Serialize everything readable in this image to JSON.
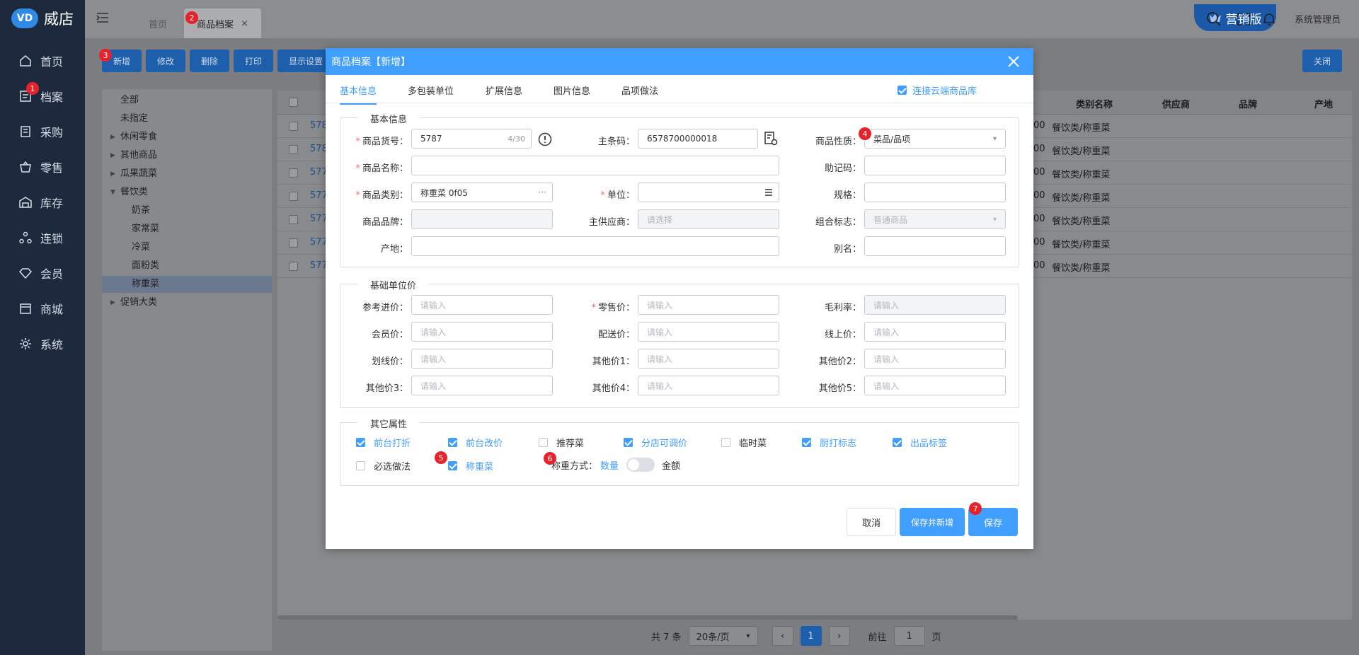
{
  "app": {
    "name": "威店",
    "logo_text": "VD"
  },
  "sidebar": {
    "items": [
      {
        "label": "首页",
        "icon": "home-icon"
      },
      {
        "label": "档案",
        "icon": "archive-icon"
      },
      {
        "label": "采购",
        "icon": "purchase-icon"
      },
      {
        "label": "零售",
        "icon": "basket-icon"
      },
      {
        "label": "库存",
        "icon": "warehouse-icon"
      },
      {
        "label": "连锁",
        "icon": "chain-icon"
      },
      {
        "label": "会员",
        "icon": "member-icon"
      },
      {
        "label": "商城",
        "icon": "shop-icon"
      },
      {
        "label": "系统",
        "icon": "gear-icon"
      }
    ]
  },
  "topbar": {
    "tabs": [
      {
        "label": "首页"
      },
      {
        "label": "商品档案",
        "close": "×"
      }
    ],
    "promo": "营销版",
    "user": "系统管理员"
  },
  "toolbar": {
    "buttons": [
      "新增",
      "修改",
      "删除",
      "打印",
      "显示设置"
    ],
    "close": "关闭"
  },
  "tree": {
    "items": [
      "全部",
      "未指定",
      "休闲零食",
      "其他商品",
      "瓜果蔬菜",
      "餐饮类",
      "奶茶",
      "家常菜",
      "冷菜",
      "面粉类",
      "称重菜",
      "促销大类"
    ]
  },
  "grid": {
    "headers": [
      "类别名称",
      "供应商",
      "品牌",
      "产地"
    ],
    "rows": [
      {
        "code": "578",
        "price": "00",
        "category": "餐饮类/称重菜"
      },
      {
        "code": "578",
        "price": "00",
        "category": "餐饮类/称重菜"
      },
      {
        "code": "577",
        "price": "00",
        "category": "餐饮类/称重菜"
      },
      {
        "code": "577",
        "price": "00",
        "category": "餐饮类/称重菜"
      },
      {
        "code": "577",
        "price": "00",
        "category": "餐饮类/称重菜"
      },
      {
        "code": "577",
        "price": "00",
        "category": "餐饮类/称重菜"
      },
      {
        "code": "577",
        "price": "00",
        "category": "餐饮类/称重菜"
      }
    ]
  },
  "pager": {
    "total": "共 7 条",
    "page_size": "20条/页",
    "current": "1",
    "goto_label": "前往",
    "goto_value": "1",
    "page_suffix": "页",
    "prev": "‹",
    "next": "›"
  },
  "badges": [
    "1",
    "2",
    "3",
    "4",
    "5",
    "6",
    "7"
  ],
  "modal": {
    "title": "商品档案【新增】",
    "tabs": [
      "基本信息",
      "多包装单位",
      "扩展信息",
      "图片信息",
      "品项做法"
    ],
    "cloud_link": "连接云端商品库",
    "basic": {
      "legend": "基本信息",
      "code_label": "商品货号：",
      "code_value": "5787",
      "code_count": "4/30",
      "barcode_label": "主条码：",
      "barcode_value": "6578700000018",
      "nature_label": "商品性质：",
      "nature_value": "菜品/品项",
      "name_label": "商品名称：",
      "mnemonic_label": "助记码：",
      "category_label": "商品类别：",
      "category_value": "称重菜  0f05",
      "category_more": "···",
      "unit_label": "单位：",
      "spec_label": "规格：",
      "brand_label": "商品品牌：",
      "supplier_label": "主供应商：",
      "supplier_placeholder": "请选择",
      "combo_label": "组合标志：",
      "combo_value": "普通商品",
      "origin_label": "产地：",
      "alias_label": "别名："
    },
    "price": {
      "legend": "基础单位价",
      "placeholder": "请输入",
      "fields": [
        {
          "label": "参考进价：",
          "required": false,
          "disabled": false
        },
        {
          "label": "零售价：",
          "required": true,
          "disabled": false
        },
        {
          "label": "毛利率：",
          "required": false,
          "disabled": true
        },
        {
          "label": "会员价：",
          "required": false,
          "disabled": false
        },
        {
          "label": "配送价：",
          "required": false,
          "disabled": false
        },
        {
          "label": "线上价：",
          "required": false,
          "disabled": false
        },
        {
          "label": "划线价：",
          "required": false,
          "disabled": false
        },
        {
          "label": "其他价1：",
          "required": false,
          "disabled": false
        },
        {
          "label": "其他价2：",
          "required": false,
          "disabled": false
        },
        {
          "label": "其他价3：",
          "required": false,
          "disabled": false
        },
        {
          "label": "其他价4：",
          "required": false,
          "disabled": false
        },
        {
          "label": "其他价5：",
          "required": false,
          "disabled": false
        }
      ]
    },
    "other": {
      "legend": "其它属性",
      "checks": [
        {
          "label": "前台打折",
          "checked": true
        },
        {
          "label": "前台改价",
          "checked": true
        },
        {
          "label": "推荐菜",
          "checked": false
        },
        {
          "label": "分店可调价",
          "checked": true
        },
        {
          "label": "临时菜",
          "checked": false
        },
        {
          "label": "厨打标志",
          "checked": true
        },
        {
          "label": "出品标签",
          "checked": true
        },
        {
          "label": "必选做法",
          "checked": false
        },
        {
          "label": "称重菜",
          "checked": true
        }
      ],
      "weigh_label": "称重方式：",
      "weigh_qty": "数量",
      "weigh_amount": "金额"
    },
    "buttons": {
      "cancel": "取消",
      "save_new": "保存并新增",
      "save": "保存"
    }
  }
}
